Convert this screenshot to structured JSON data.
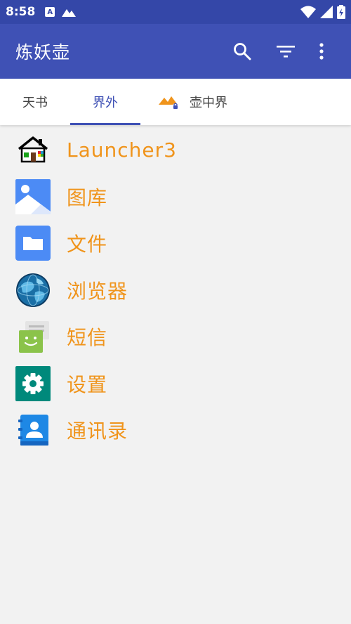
{
  "status_bar": {
    "time": "8:58",
    "badge": "A"
  },
  "app_bar": {
    "title": "炼妖壶",
    "icons": [
      "search-icon",
      "filter-icon",
      "more-vert-icon"
    ]
  },
  "tabs": [
    {
      "label": "天书"
    },
    {
      "label": "界外",
      "selected": true
    },
    {
      "label": "壶中界",
      "icon": "island-icon"
    }
  ],
  "apps": [
    {
      "label": "Launcher3",
      "icon": "launcher-house-icon"
    },
    {
      "label": "图库",
      "icon": "gallery-icon"
    },
    {
      "label": "文件",
      "icon": "folder-icon"
    },
    {
      "label": "浏览器",
      "icon": "globe-icon"
    },
    {
      "label": "短信",
      "icon": "messaging-icon"
    },
    {
      "label": "设置",
      "icon": "settings-gear-icon"
    },
    {
      "label": "通讯录",
      "icon": "contacts-icon"
    }
  ],
  "colors": {
    "status_bar": "#3447a8",
    "app_bar": "#3f51b5",
    "label": "#f0941b",
    "background": "#f2f2f2"
  }
}
